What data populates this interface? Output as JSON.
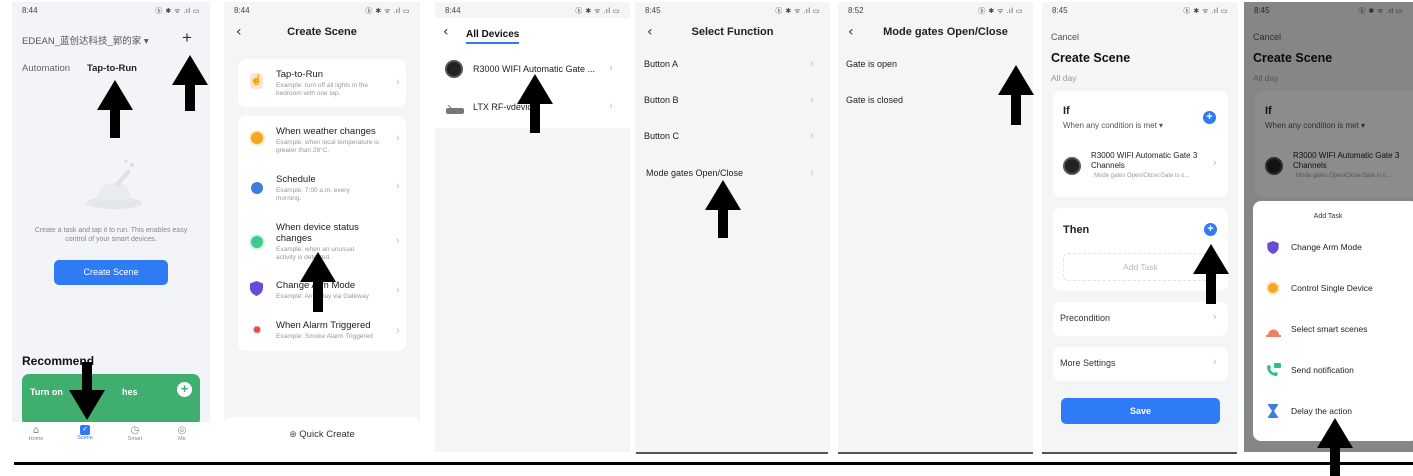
{
  "colors": {
    "accent": "#2f7bf6",
    "green": "#3fae6e",
    "purple": "#6a4bd8",
    "red": "#e24848",
    "orange": "#f5a623",
    "overlay": "#8c8c8c"
  },
  "status_icons": "ⓑ ✱ ᯤ .ıl ▭",
  "s1": {
    "time": "8:44",
    "home_title": "EDEAN_蓝创达科技_郭的家 ▾",
    "add_glyph": "+",
    "tab_automation": "Automation",
    "tab_tap": "Tap-to-Run",
    "empty_text": "Create a task and tap it to run. This enables easy control of your smart devices.",
    "create_btn": "Create Scene",
    "recommend": "Recommend",
    "promo_left": "Turn on",
    "promo_right": "hes",
    "promo_plus": "+",
    "nav": [
      "Home",
      "Scene",
      "Smart",
      "Me"
    ]
  },
  "s2": {
    "time": "8:44",
    "title": "Create Scene",
    "options": [
      {
        "title": "Tap-to-Run",
        "sub": "Example: turn off all lights in the bedroom with one tap."
      },
      {
        "title": "When weather changes",
        "sub": "Example: when local temperature is greater than 28°C."
      },
      {
        "title": "Schedule",
        "sub": "Example: 7:00 a.m. every morning."
      },
      {
        "title": "When device status changes",
        "sub": "Example: when an unusual activity is detected."
      },
      {
        "title": "Change Arm Mode",
        "sub": "Example: Arm Stay via Gateway"
      },
      {
        "title": "When Alarm Triggered",
        "sub": "Example: Smoke Alarm Triggered"
      }
    ],
    "quick_create": "Quick Create"
  },
  "s3": {
    "time": "8:44",
    "title": "All Devices",
    "devices": [
      "R3000 WIFI Automatic Gate ...",
      "LTX RF-vdevice"
    ]
  },
  "s4": {
    "time": "8:45",
    "title": "Select Function",
    "functions": [
      "Button A",
      "Button B",
      "Button C",
      "Mode gates Open/Close"
    ]
  },
  "s5": {
    "time": "8:52",
    "title": "Mode gates Open/Close",
    "options": [
      "Gate is open",
      "Gate is closed"
    ]
  },
  "s6": {
    "time": "8:45",
    "cancel": "Cancel",
    "title": "Create Scene",
    "subtitle": "All day",
    "if_label": "If",
    "if_condition": "When any condition is met ▾",
    "device_name": "R3000 WIFI Automatic Gate 3 Channels",
    "device_detail": "Mode gates Open/Close:Gate is o...",
    "then_label": "Then",
    "add_task": "Add Task",
    "precondition": "Precondition",
    "more_settings": "More Settings",
    "save": "Save"
  },
  "s7": {
    "time": "8:45",
    "cancel": "Cancel",
    "title": "Create Scene",
    "subtitle": "All day",
    "if_label": "If",
    "if_condition": "When any condition is met ▾",
    "device_name": "R3000 WIFI Automatic Gate 3 Channels",
    "device_detail": "Mode gates Open/Close:Gate is o...",
    "sheet_title": "Add Task",
    "tasks": [
      "Change Arm Mode",
      "Control Single Device",
      "Select smart scenes",
      "Send notification",
      "Delay the action"
    ]
  }
}
